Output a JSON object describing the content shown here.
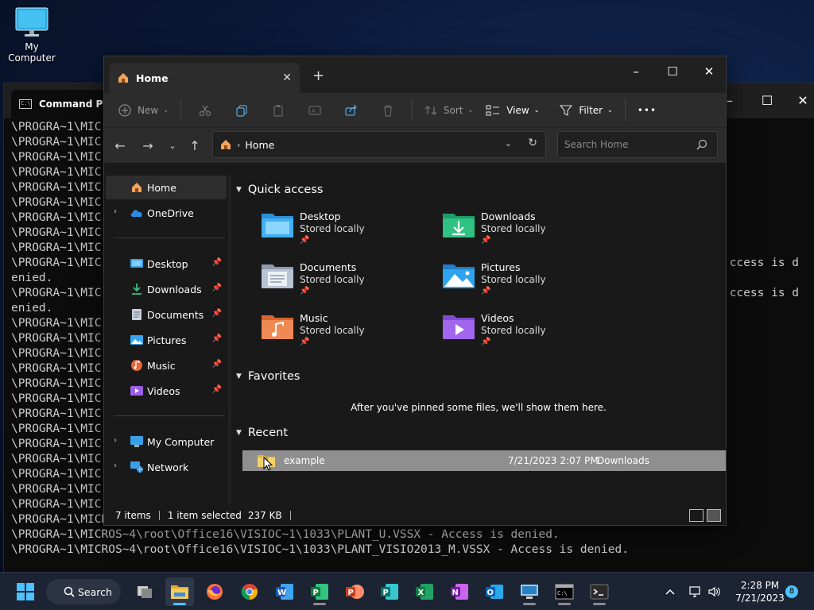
{
  "desktop": {
    "icon_label": "My Computer"
  },
  "cmd": {
    "title": "Command Prompt",
    "lines": [
      "\\PROGRA~1\\MIC",
      "\\PROGRA~1\\MIC",
      "\\PROGRA~1\\MIC",
      "\\PROGRA~1\\MIC",
      "\\PROGRA~1\\MIC",
      "\\PROGRA~1\\MIC",
      "\\PROGRA~1\\MIC",
      "\\PROGRA~1\\MIC",
      "\\PROGRA~1\\MIC",
      "\\PROGRA~1\\MIC",
      "enied.",
      "\\PROGRA~1\\MIC",
      "enied.",
      "\\PROGRA~1\\MIC",
      "\\PROGRA~1\\MIC",
      "\\PROGRA~1\\MIC",
      "\\PROGRA~1\\MIC",
      "\\PROGRA~1\\MIC",
      "\\PROGRA~1\\MIC",
      "\\PROGRA~1\\MIC",
      "\\PROGRA~1\\MIC",
      "\\PROGRA~1\\MIC",
      "\\PROGRA~1\\MIC",
      "\\PROGRA~1\\MIC",
      "\\PROGRA~1\\MIC",
      "\\PROGRA~1\\MIC",
      "\\PROGRA~1\\MICROS~4\\root\\Office16\\VISIOC~1\\1033\\PLANT_M.VSSX - Access is denied.",
      "\\PROGRA~1\\MICROS~4\\root\\Office16\\VISIOC~1\\1033\\PLANT_U.VSSX - Access is denied.",
      "\\PROGRA~1\\MICROS~4\\root\\Office16\\VISIOC~1\\1033\\PLANT_VISIO2013_M.VSSX - Access is denied."
    ],
    "right_fragments": [
      "ccess is d",
      "ccess is d"
    ]
  },
  "explorer": {
    "tab_title": "Home",
    "toolbar": {
      "new_label": "New",
      "sort_label": "Sort",
      "view_label": "View",
      "filter_label": "Filter",
      "more_label": "•••"
    },
    "address": {
      "crumb": "Home"
    },
    "search": {
      "placeholder": "Search Home"
    },
    "sidebar": {
      "home": "Home",
      "onedrive": "OneDrive",
      "pinned": [
        "Desktop",
        "Downloads",
        "Documents",
        "Pictures",
        "Music",
        "Videos"
      ],
      "my_computer": "My Computer",
      "network": "Network"
    },
    "quick_access": {
      "heading": "Quick access",
      "items": [
        {
          "name": "Desktop",
          "status": "Stored locally"
        },
        {
          "name": "Downloads",
          "status": "Stored locally"
        },
        {
          "name": "Documents",
          "status": "Stored locally"
        },
        {
          "name": "Pictures",
          "status": "Stored locally"
        },
        {
          "name": "Music",
          "status": "Stored locally"
        },
        {
          "name": "Videos",
          "status": "Stored locally"
        }
      ]
    },
    "favorites": {
      "heading": "Favorites",
      "empty_message": "After you've pinned some files, we'll show them here."
    },
    "recent": {
      "heading": "Recent",
      "rows": [
        {
          "name": "example",
          "date": "7/21/2023 2:07 PM",
          "location": "Downloads"
        }
      ]
    },
    "status": {
      "items": "7 items",
      "selected": "1 item selected",
      "size": "237 KB"
    }
  },
  "taskbar": {
    "search_label": "Search",
    "time": "2:28 PM",
    "date": "7/21/2023",
    "notification_count": "8"
  },
  "colors": {
    "accent": "#4cc2ff",
    "selected_row": "#8f8f8f",
    "window_bg": "#191919"
  }
}
